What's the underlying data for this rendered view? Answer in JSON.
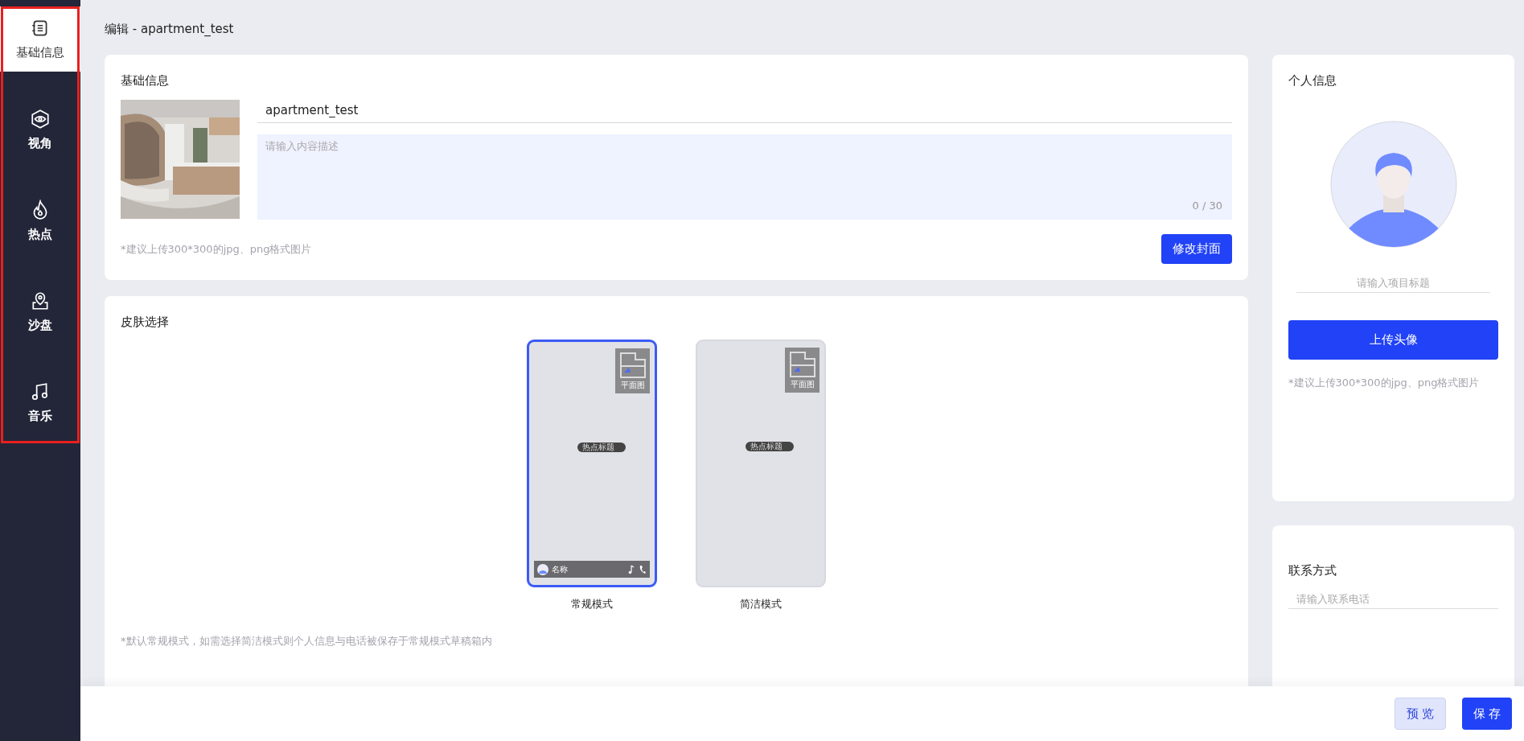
{
  "sidebar": {
    "outlined": true,
    "items": [
      {
        "label": "基础信息",
        "selected": true
      },
      {
        "label": "视角",
        "selected": false
      },
      {
        "label": "热点",
        "selected": false
      },
      {
        "label": "沙盘",
        "selected": false
      },
      {
        "label": "音乐",
        "selected": false
      }
    ]
  },
  "page_title": "编辑 - apartment_test",
  "basic_info": {
    "title": "基础信息",
    "name_field": {
      "value": "apartment_test"
    },
    "description_field": {
      "placeholder": "请输入内容描述",
      "counter": "0 / 30"
    },
    "hint": "*建议上传300*300的jpg、png格式图片",
    "button": "修改封面"
  },
  "skin": {
    "title": "皮肤选择",
    "options": [
      {
        "label": "常规模式",
        "selected": true,
        "kind": "regular",
        "map_label": "平面图",
        "hotspot": "热点标题",
        "bar_name": "名称"
      },
      {
        "label": "简洁模式",
        "selected": false,
        "kind": "simple",
        "map_label": "平面图",
        "hotspot": "热点标题"
      }
    ],
    "note": "*默认常规模式，如需选择简洁模式则个人信息与电话被保存于常规模式草稿箱内"
  },
  "personal": {
    "title": "个人信息",
    "title_field": {
      "placeholder": "请输入项目标题"
    },
    "button": "上传头像",
    "hint": "*建议上传300*300的jpg、png格式图片"
  },
  "contact": {
    "title": "联系方式",
    "phone_field": {
      "placeholder": "请输入联系电话"
    }
  },
  "footer": {
    "buttons": [
      {
        "label": "预览",
        "kind": "secondary"
      },
      {
        "label": "保存",
        "kind": "primary"
      }
    ]
  }
}
